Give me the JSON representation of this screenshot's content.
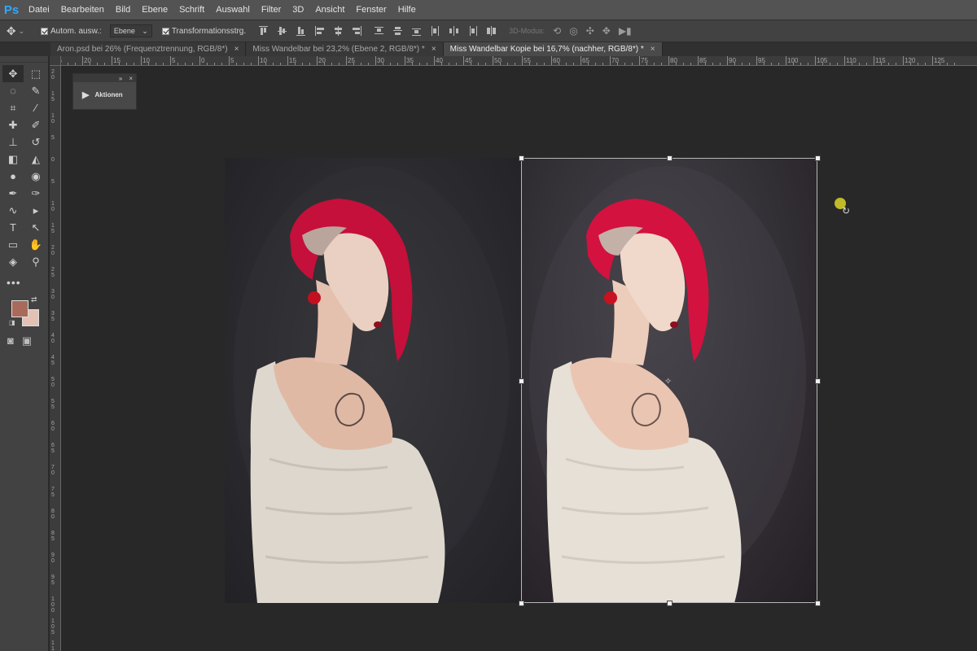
{
  "app": {
    "logo": "Ps"
  },
  "menu": [
    "Datei",
    "Bearbeiten",
    "Bild",
    "Ebene",
    "Schrift",
    "Auswahl",
    "Filter",
    "3D",
    "Ansicht",
    "Fenster",
    "Hilfe"
  ],
  "options": {
    "auto_select_label": "Autom. ausw.:",
    "auto_select_checked": true,
    "layer_select_value": "Ebene",
    "transform_controls_label": "Transformationsstrg.",
    "transform_controls_checked": true,
    "mode_3d_label": "3D-Modus:"
  },
  "tabs": [
    {
      "title": "Aron.psd bei 26% (Frequenztrennung, RGB/8*)",
      "active": false
    },
    {
      "title": "Miss Wandelbar bei 23,2% (Ebene 2, RGB/8*) *",
      "active": false
    },
    {
      "title": "Miss Wandelbar Kopie bei 16,7% (nachher, RGB/8*) *",
      "active": true
    }
  ],
  "tab_close_glyph": "×",
  "colors": {
    "foreground": "#a86b5b",
    "background": "#e4c2b3",
    "accent": "#31a8ff"
  },
  "panels": {
    "actions": {
      "label": "Aktionen"
    }
  },
  "ruler": {
    "top_labels": [
      "25",
      "20",
      "15",
      "10",
      "5",
      "0",
      "5",
      "10",
      "15",
      "20",
      "25",
      "30",
      "35",
      "40",
      "45",
      "50",
      "55",
      "60",
      "65",
      "70",
      "75",
      "80",
      "85",
      "90",
      "95",
      "100",
      "105",
      "110",
      "115",
      "120",
      "125"
    ],
    "left_labels": [
      "2 0",
      "1 5",
      "1 0",
      "5",
      "0",
      "5",
      "1 0",
      "1 5",
      "2 0",
      "2 5",
      "3 0",
      "3 5",
      "4 0",
      "4 5",
      "5 0",
      "5 5",
      "6 0",
      "6 5",
      "7 0",
      "7 5",
      "8 0",
      "8 5",
      "9 0",
      "9 5",
      "1 0 0",
      "1 0 5",
      "1 1 0"
    ]
  },
  "tools": [
    {
      "name": "move-tool-icon",
      "glyph": "✥",
      "selected": true
    },
    {
      "name": "marquee-tool-icon",
      "glyph": "⬚"
    },
    {
      "name": "lasso-tool-icon",
      "glyph": "◌"
    },
    {
      "name": "quick-selection-tool-icon",
      "glyph": "✎"
    },
    {
      "name": "crop-tool-icon",
      "glyph": "⌗"
    },
    {
      "name": "eyedropper-tool-icon",
      "glyph": "⁄"
    },
    {
      "name": "healing-brush-tool-icon",
      "glyph": "✚"
    },
    {
      "name": "brush-tool-icon",
      "glyph": "✐"
    },
    {
      "name": "clone-stamp-tool-icon",
      "glyph": "⊥"
    },
    {
      "name": "history-brush-tool-icon",
      "glyph": "↺"
    },
    {
      "name": "eraser-tool-icon",
      "glyph": "◧"
    },
    {
      "name": "paint-bucket-tool-icon",
      "glyph": "◭"
    },
    {
      "name": "blur-tool-icon",
      "glyph": "●"
    },
    {
      "name": "dodge-tool-icon",
      "glyph": "◉"
    },
    {
      "name": "pen-tool-icon",
      "glyph": "✒"
    },
    {
      "name": "freeform-pen-tool-icon",
      "glyph": "✑"
    },
    {
      "name": "curvature-pen-tool-icon",
      "glyph": "∿"
    },
    {
      "name": "path-selection-tool-icon",
      "glyph": "▸"
    },
    {
      "name": "type-tool-icon",
      "glyph": "T"
    },
    {
      "name": "direct-selection-tool-icon",
      "glyph": "↖"
    },
    {
      "name": "rectangle-tool-icon",
      "glyph": "▭"
    },
    {
      "name": "hand-tool-icon",
      "glyph": "✋"
    },
    {
      "name": "3d-rotate-tool-icon",
      "glyph": "◈"
    },
    {
      "name": "zoom-tool-icon",
      "glyph": "⚲"
    }
  ],
  "toolbar_extras": {
    "more_glyph": "•••",
    "swap_glyph": "⇄",
    "default_glyph": "◨",
    "quick_mask_glyph": "◙",
    "screen_mode_glyph": "▣"
  },
  "panel_glyphs": {
    "collapse": "»",
    "close": "×",
    "play": "▶"
  },
  "option_glyphs": {
    "move": "✥",
    "chevron": "⌄",
    "select_chevron": "⌄"
  },
  "icons_3d": [
    "⟲",
    "◎",
    "✣",
    "✥",
    "▶▮"
  ],
  "canvas_glyphs": {
    "pivot": "✧",
    "rotate_cursor": "↻"
  }
}
